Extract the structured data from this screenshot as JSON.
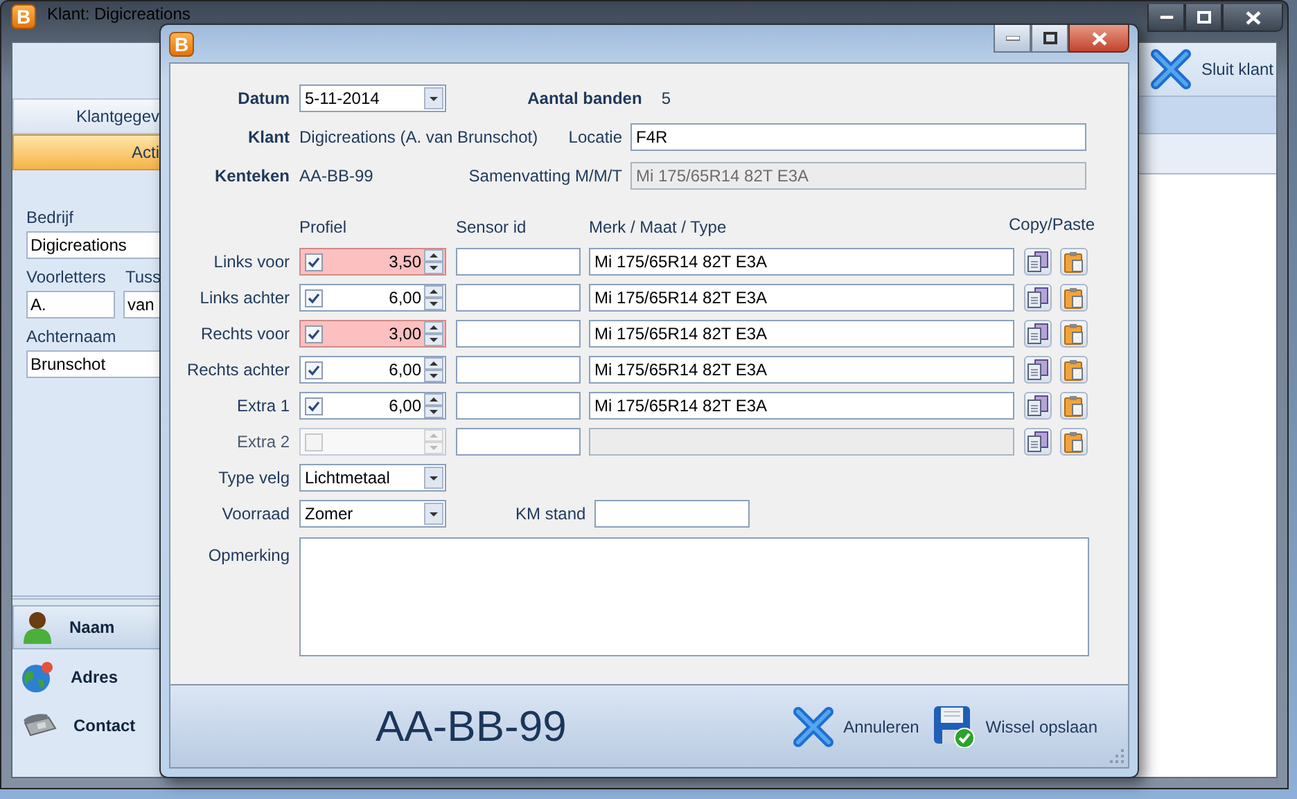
{
  "main_window": {
    "icon_letter": "B",
    "title": "Klant: Digicreations",
    "close_client_button": "Sluit klant",
    "tabs": [
      {
        "label": "Klantgegev",
        "selected": false
      },
      {
        "label": "Acti",
        "selected": true
      }
    ],
    "company": {
      "label": "Bedrijf",
      "value": "Digicreations"
    },
    "initials": {
      "label": "Voorletters",
      "value": "A."
    },
    "infix": {
      "label": "Tuss",
      "value": "van"
    },
    "surname": {
      "label": "Achternaam",
      "value": "Brunschot"
    },
    "nav": [
      {
        "label": "Naam",
        "selected": true
      },
      {
        "label": "Adres",
        "selected": false
      },
      {
        "label": "Contact",
        "selected": false
      }
    ]
  },
  "dialog": {
    "icon_letter": "B",
    "date": {
      "label": "Datum",
      "value": "5-11-2014"
    },
    "tire_count": {
      "label": "Aantal banden",
      "value": "5"
    },
    "customer": {
      "label": "Klant",
      "value": "Digicreations (A. van Brunschot)"
    },
    "location": {
      "label": "Locatie",
      "value": "F4R"
    },
    "plate": {
      "label": "Kenteken",
      "value": "AA-BB-99"
    },
    "summary": {
      "label": "Samenvatting M/M/T",
      "value": "Mi 175/65R14 82T E3A",
      "disabled": true
    },
    "tire_columns": [
      "Profiel",
      "Sensor id",
      "Merk / Maat / Type",
      "Copy/Paste"
    ],
    "tires": [
      {
        "label": "Links voor",
        "checked": true,
        "disabled": false,
        "profile": "3,50",
        "warning": true,
        "type": "Mi 175/65R14 82T E3A"
      },
      {
        "label": "Links achter",
        "checked": true,
        "disabled": false,
        "profile": "6,00",
        "warning": false,
        "type": "Mi 175/65R14 82T E3A"
      },
      {
        "label": "Rechts voor",
        "checked": true,
        "disabled": false,
        "profile": "3,00",
        "warning": true,
        "type": "Mi 175/65R14 82T E3A"
      },
      {
        "label": "Rechts achter",
        "checked": true,
        "disabled": false,
        "profile": "6,00",
        "warning": false,
        "type": "Mi 175/65R14 82T E3A"
      },
      {
        "label": "Extra 1",
        "checked": true,
        "disabled": false,
        "profile": "6,00",
        "warning": false,
        "type": "Mi 175/65R14 82T E3A"
      },
      {
        "label": "Extra 2",
        "checked": false,
        "disabled": true,
        "warning": false
      }
    ],
    "rim_type": {
      "label": "Type velg",
      "value": "Lichtmetaal"
    },
    "stock": {
      "label": "Voorraad",
      "value": "Zomer"
    },
    "mileage": {
      "label": "KM stand"
    },
    "remark": {
      "label": "Opmerking"
    },
    "plate_display": "AA-BB-99",
    "buttons": [
      {
        "label": "Annuleren",
        "kind": "cancel"
      },
      {
        "label": "Wissel opslaan",
        "kind": "save"
      }
    ]
  }
}
